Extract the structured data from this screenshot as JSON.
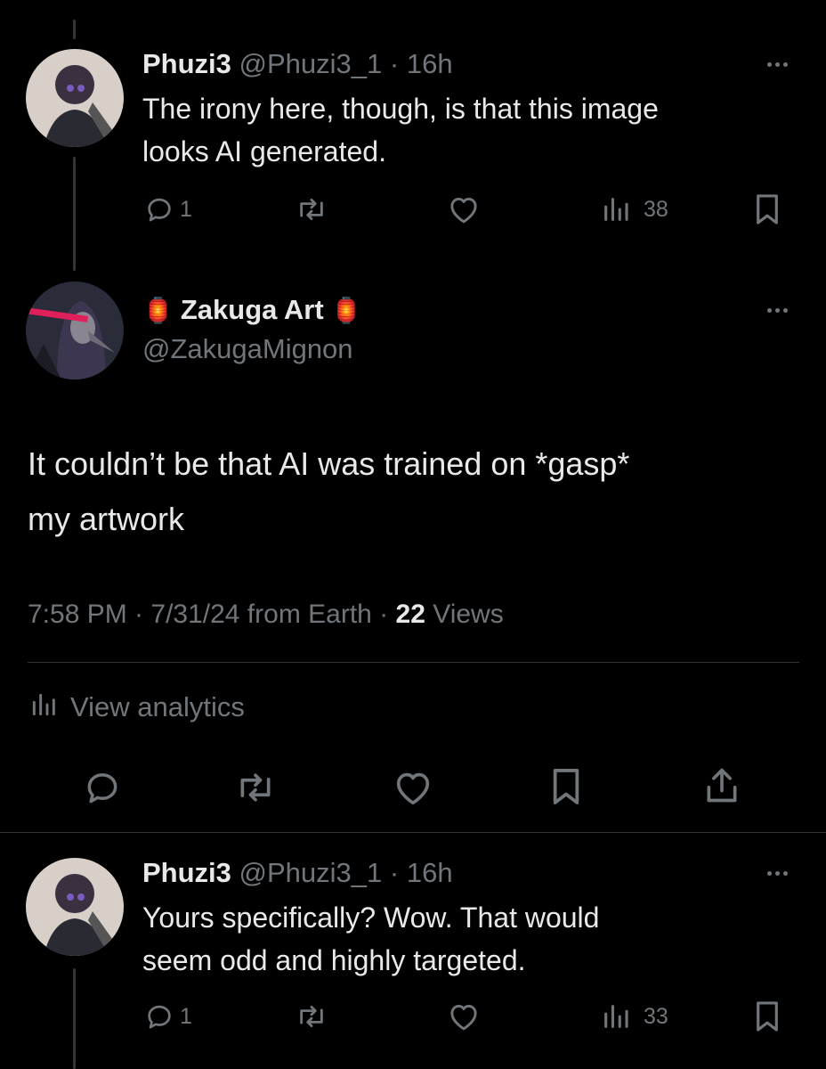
{
  "reply1": {
    "name": "Phuzi3",
    "handle": "@Phuzi3_1",
    "time": "16h",
    "text_line1": "The irony here, though, is that this image",
    "text_line2": "looks AI generated.",
    "reply_count": "1",
    "view_count": "38"
  },
  "main": {
    "emoji": "🏮",
    "name": "Zakuga Art",
    "handle": "@ZakugaMignon",
    "text_line1": "It couldn’t be that AI was trained on *gasp*",
    "text_line2": "my artwork",
    "timestamp": "7:58 PM · 7/31/24 from Earth · ",
    "views_number": "22",
    "views_label": " Views",
    "analytics_label": "View analytics"
  },
  "reply2": {
    "name": "Phuzi3",
    "handle": "@Phuzi3_1",
    "time": "16h",
    "text_line1": "Yours specifically?  Wow.  That would",
    "text_line2": "seem odd and highly targeted.",
    "reply_count": "1",
    "view_count": "33"
  },
  "colors": {
    "background": "#000000",
    "text_primary": "#e7e9ea",
    "text_secondary": "#71767b",
    "divider": "#2f3336"
  }
}
